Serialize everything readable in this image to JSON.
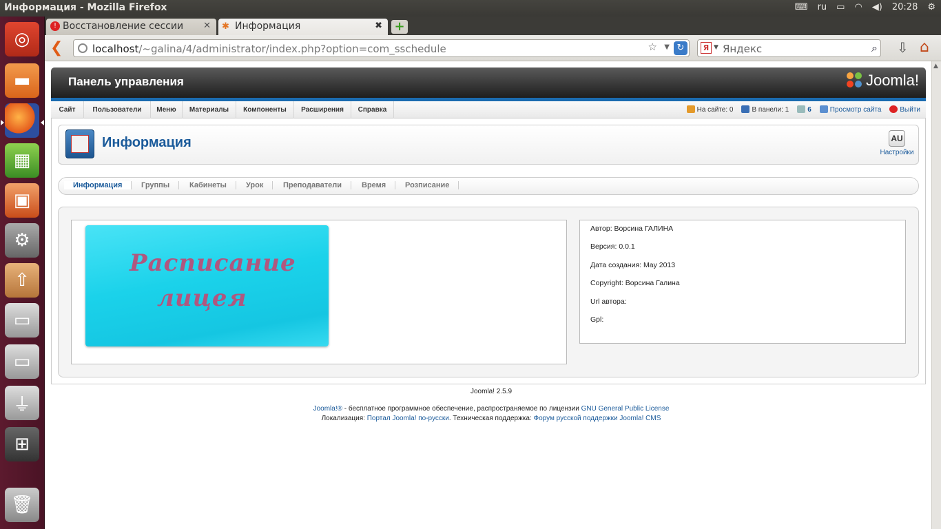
{
  "window": {
    "title": "Информация - Mozilla Firefox"
  },
  "tray": {
    "keyboard_layout": "ru",
    "clock": "20:28"
  },
  "browser": {
    "tabs": [
      {
        "label": "Восстановление сессии"
      },
      {
        "label": "Информация"
      }
    ],
    "url_host": "localhost",
    "url_path": "/~galina/4/administrator/index.php?option=com_sschedule",
    "search_placeholder": "Яндекс",
    "search_engine_letter": "Я"
  },
  "joomla": {
    "header_title": "Панель управления",
    "logo_text": "Joomla!",
    "menu": [
      "Сайт",
      "Пользователи",
      "Меню",
      "Материалы",
      "Компоненты",
      "Расширения",
      "Справка"
    ],
    "status": {
      "on_site": "На сайте: 0",
      "in_panel": "В панели: 1",
      "messages": "6",
      "view_site": "Просмотр сайта",
      "logout": "Выйти"
    },
    "page_title": "Информация",
    "settings_label": "Настройки",
    "settings_glyph": "AU",
    "submenu": [
      "Информация",
      "Группы",
      "Кабинеты",
      "Урок",
      "Преподаватели",
      "Время",
      "Розписание"
    ],
    "banner": {
      "line1": "Расписание",
      "line2": "лицея"
    },
    "info": [
      "Автор: Ворсина ГАЛИНА",
      "Версия: 0.0.1",
      "Дата создания: May 2013",
      "Copyright: Ворсина Галина",
      "Url автора:",
      "Gpl:"
    ],
    "footer": {
      "version": "Joomla! 2.5.9",
      "l1_link": "Joomla!®",
      "l1_text": " - бесплатное программное обеспечение, распространяемое по лицензии ",
      "l1_link2": "GNU General Public License",
      "l2_text": "Локализация: ",
      "l2_link": "Портал Joomla! по-русски",
      "l2_text2": ". Техническая поддержка: ",
      "l2_link2": "Форум русской поддержки Joomla! CMS"
    }
  },
  "colors": {
    "launcher": "#5c1a2e",
    "joomla_blue": "#1a5a9a",
    "banner_cyan": "#1bd2ea",
    "banner_text": "#b0577f"
  }
}
